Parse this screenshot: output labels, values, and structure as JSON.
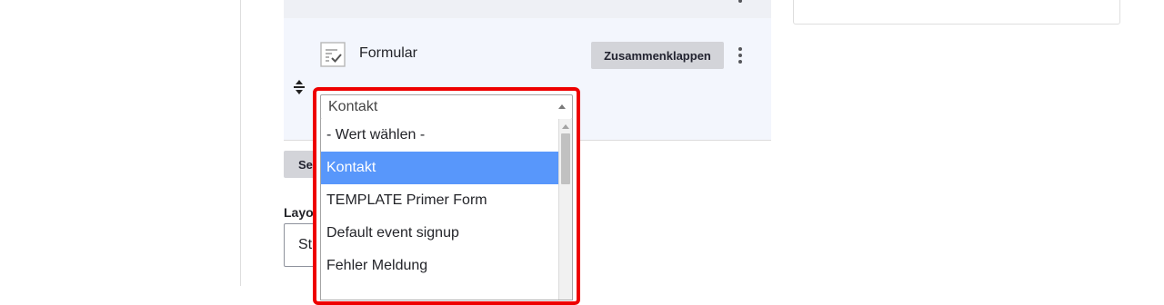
{
  "paragraph": {
    "title": "Formular",
    "collapse_button": "Zusammenklappen",
    "form_icon": "form-check-icon",
    "more_icon": "kebab-menu-icon",
    "drag_icon": "drag-handle-icon"
  },
  "below": {
    "select_button_partial": "Se",
    "layout_label_partial": "Layou",
    "layout_select_partial": "St"
  },
  "form_select": {
    "value": "Kontakt",
    "options": [
      "- Wert wählen -",
      "Kontakt",
      "TEMPLATE Primer Form",
      "Default event signup",
      "Fehler Meldung"
    ],
    "selected_index": 1
  },
  "colors": {
    "highlight_border": "#ee0000",
    "selected_option": "#5897fb",
    "panel_background": "#f3f6fd",
    "button_background": "#d3d4d9"
  }
}
